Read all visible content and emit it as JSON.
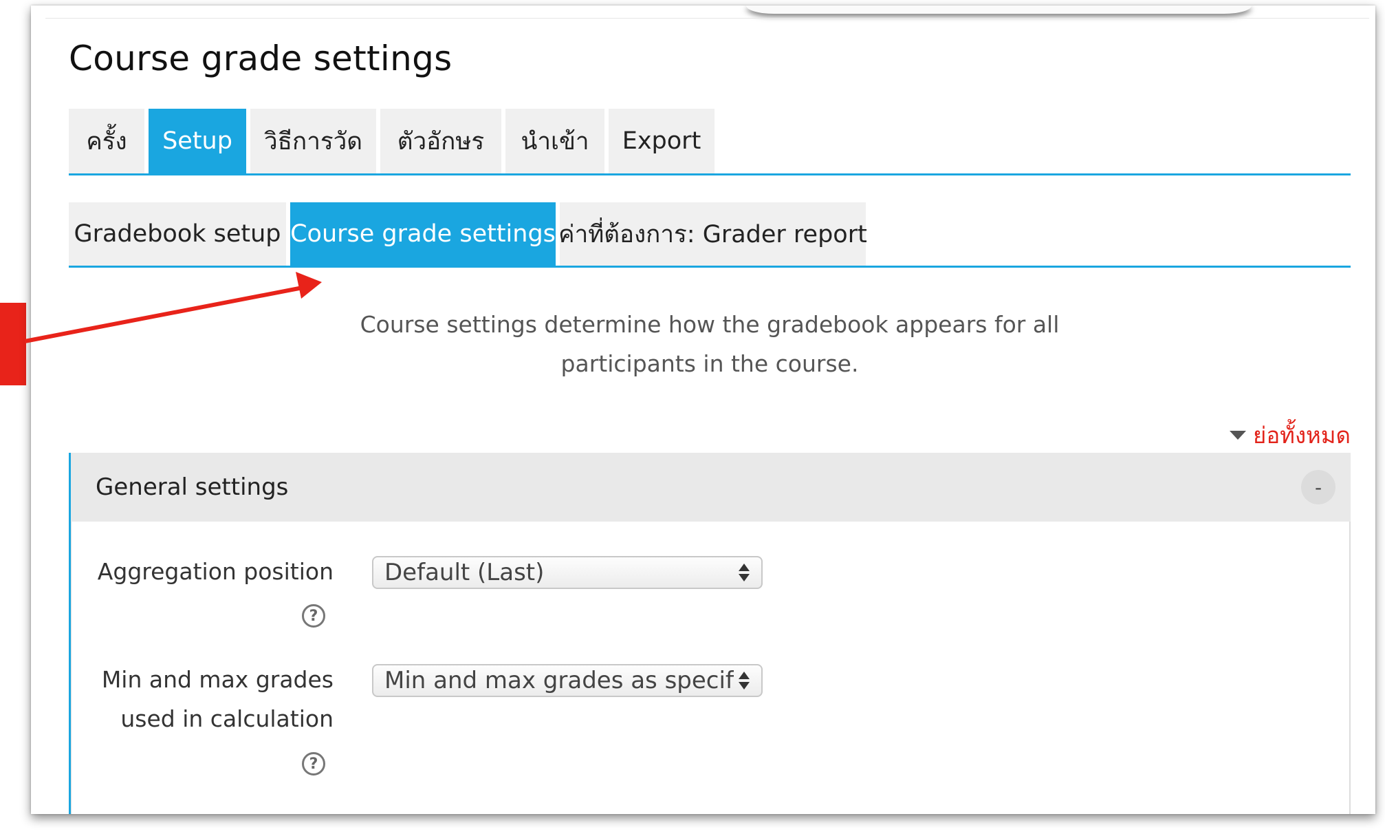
{
  "page": {
    "title": "Course grade settings"
  },
  "primary_tabs": [
    {
      "label": "ครั้ง",
      "active": false
    },
    {
      "label": "Setup",
      "active": true
    },
    {
      "label": "วิธีการวัด",
      "active": false
    },
    {
      "label": "ตัวอักษร",
      "active": false
    },
    {
      "label": "นำเข้า",
      "active": false
    },
    {
      "label": "Export",
      "active": false
    }
  ],
  "secondary_tabs": [
    {
      "label": "Gradebook setup",
      "active": false
    },
    {
      "label": "Course grade settings",
      "active": true
    },
    {
      "label": "ค่าที่ต้องการ: Grader report",
      "active": false
    }
  ],
  "intro": {
    "line1": "Course settings determine how the gradebook appears for all",
    "line2": "participants in the course."
  },
  "collapse_all": {
    "label": "ย่อทั้งหมด"
  },
  "section": {
    "title": "General settings",
    "toggle": "-"
  },
  "fields": {
    "aggregation_position": {
      "label": "Aggregation position",
      "value": "Default (Last)"
    },
    "min_max_grades": {
      "label_line1": "Min and max grades",
      "label_line2": "used in calculation",
      "value": "Min and max grades as specified"
    }
  },
  "help_icon": {
    "glyph": "?"
  },
  "colors": {
    "accent": "#1aa6e0",
    "annotation": "#e8231a",
    "link_red": "#e2231a"
  }
}
